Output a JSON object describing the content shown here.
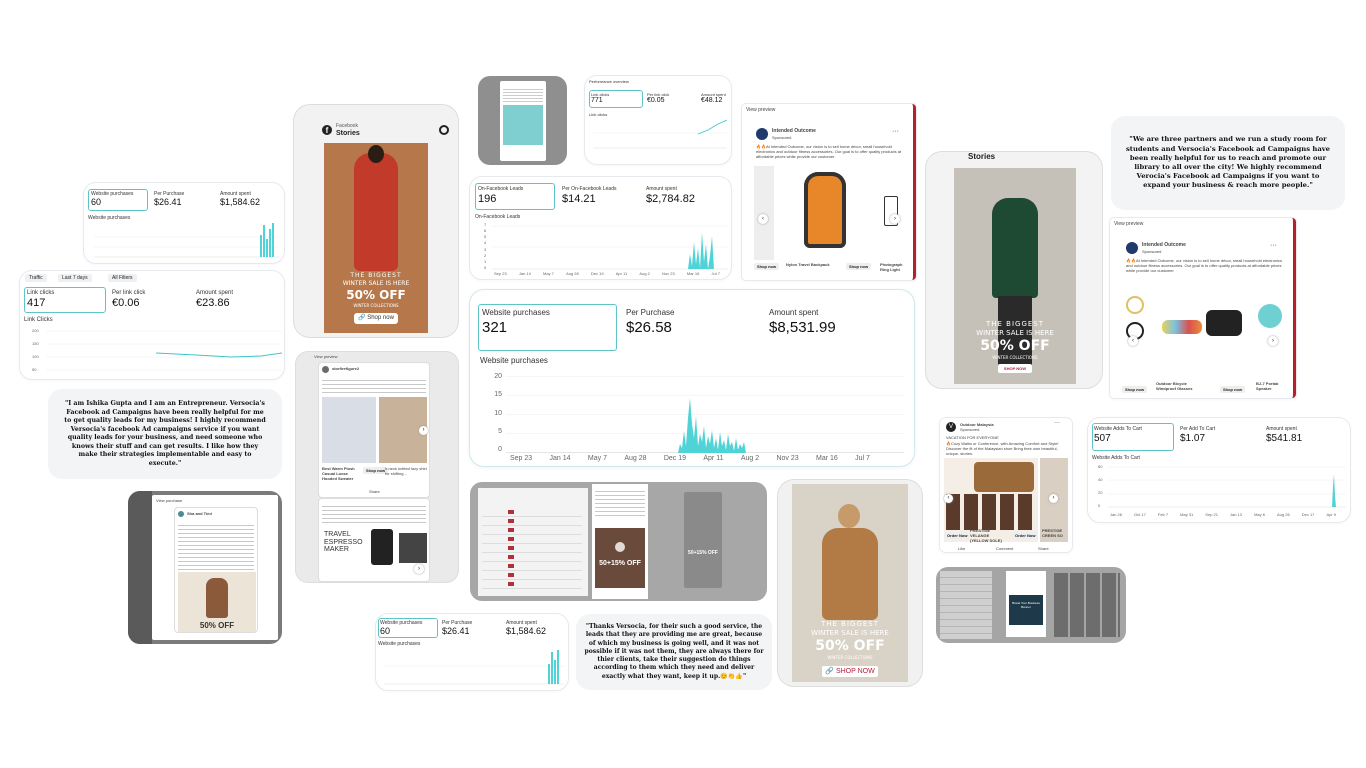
{
  "palette": {
    "teal": "#3ec6c9",
    "bar": "#4fd3d6",
    "card_border": "#5fc4c8",
    "dark_red": "#8a2020"
  },
  "card_a": {
    "m1_label": "Website purchases",
    "m1_value": "60",
    "m2_label": "Per Purchase",
    "m2_value": "$26.41",
    "m3_label": "Amount spent",
    "m3_value": "$1,584.62",
    "chart_label": "Website purchases"
  },
  "card_b": {
    "filter1": "Traffic",
    "filter2": "Last 7 days",
    "filter3": "All Filters",
    "m1_label": "Link clicks",
    "m1_value": "417",
    "m2_label": "Per link click",
    "m2_value": "€0.06",
    "m3_label": "Amount spent",
    "m3_value": "€23.86",
    "chart_label": "Link Clicks",
    "y_ticks": [
      "200",
      "150",
      "100",
      "50"
    ]
  },
  "quote1": "\"I am Ishika Gupta and I am an Entrepreneur. Versocia's Facebook ad Campaigns have been really helpful for me to get quality leads for my business! I highly recommend Versocia's facebook Ad campaigns service if you want quality leads for your business, and need someone who knows their stuff and can get results. I like how they make their strategies implementable and easy to execute.\"",
  "quote2": "\"We are three partners and we run a study room for students and Versocia's Facebook ad Campaigns have been really helpful for us to reach and promote our library to all over the city! We highly recommend Verocia's Facebook ad Campaigns if you want to expand your business & reach more people.\"",
  "quote3": "\"Thanks Versocia, for their such a good service, the leads that they are providing me are great, because of which my business is going well, and it was not possible if it was not them, they are always there for thier clients, take their suggestion do things according to them which they need and deliver exactly what they want, keep it up.😊👏👍\"",
  "story1": {
    "platform": "Facebook",
    "sub": "Stories",
    "line1": "THE BIGGEST",
    "line2": "WINTER SALE IS HERE",
    "big": "50% OFF",
    "line3": "WINTER COLLECTIONS",
    "cta": "Shop now"
  },
  "story2": {
    "header": "Stories",
    "line1": "THE BIGGEST",
    "line2": "WINTER SALE IS HERE",
    "big": "50% OFF",
    "line3": "WINTER COLLECTIONS",
    "cta": "SHOP NOW"
  },
  "story3": {
    "line1": "THE BIGGEST",
    "line2": "WINTER SALE IS HERE",
    "big": "50% OFF",
    "line3": "WINTER COLLECTIONS",
    "cta": "SHOP NOW"
  },
  "perf_small": {
    "title": "Performance overview",
    "m1_label": "Link clicks",
    "m1_value": "771",
    "m2_label": "Per link click",
    "m2_value": "€0.05",
    "m3_label": "Amount spent",
    "m3_value": "€48.12",
    "chart_label": "Link clicks"
  },
  "leads": {
    "m1_label": "On-Facebook Leads",
    "m1_value": "196",
    "m2_label": "Per On-Facebook Leads",
    "m2_value": "$14.21",
    "m3_label": "Amount spent",
    "m3_value": "$2,784.82",
    "chart_label": "On-Facebook Leads",
    "y_ticks": [
      "7",
      "6",
      "5",
      "4",
      "3",
      "2",
      "1",
      "0"
    ],
    "x_ticks": [
      "Sep 23",
      "Jan 14",
      "May 7",
      "Aug 28",
      "Dec 19",
      "Apr 11",
      "Aug 2",
      "Nov 23",
      "Mar 16",
      "Jul 7"
    ]
  },
  "main": {
    "m1_label": "Website purchases",
    "m1_value": "321",
    "m2_label": "Per Purchase",
    "m2_value": "$26.58",
    "m3_label": "Amount spent",
    "m3_value": "$8,531.99",
    "chart_label": "Website purchases",
    "y_ticks": [
      "20",
      "15",
      "10",
      "5",
      "0"
    ],
    "x_ticks": [
      "Sep 23",
      "Jan 14",
      "May 7",
      "Aug 28",
      "Dec 19",
      "Apr 11",
      "Aug 2",
      "Nov 23",
      "Mar 16",
      "Jul 7"
    ]
  },
  "adds": {
    "m1_label": "Website Adds To Cart",
    "m1_value": "507",
    "m2_label": "Per Add To Cart",
    "m2_value": "$1.07",
    "m3_label": "Amount spent",
    "m3_value": "$541.81",
    "chart_label": "Website Adds To Cart",
    "y_ticks": [
      "60",
      "40",
      "20",
      "0"
    ],
    "x_ticks": [
      "Jan 26",
      "Oct 17",
      "Feb 7",
      "May 31",
      "Sep 21",
      "Jan 13",
      "May 6",
      "Aug 26",
      "Dec 17",
      "Apr 9"
    ]
  },
  "view1": {
    "title": "View preview",
    "page": "Intended Outcome",
    "sponsored": "Sponsored",
    "body": "🔥🔥At Intended Outcome, our vision is to sell home décor, small household electronics and outdoor fitness accessories. Our goal is to offer quality products at affordable prices while provide our customer",
    "item1": "Shop now",
    "item2": "Nylon Travel Backpack",
    "item2_btn": "Shop now",
    "item3": "Photograph Ring Light"
  },
  "view2": {
    "title": "View preview",
    "page": "Intended Outcome",
    "sponsored": "Sponsored",
    "body": "🔥🔥At Intended Outcome, our vision is to sell home décor, small household electronics and outdoor fitness accessories. Our goal is to offer quality products at affordable prices while provide our customer",
    "item1": "Shop now",
    "item2": "Outdoor Bicycle Windproof Glasses",
    "item2_btn": "Shop now",
    "item3": "BJ-7 Portab Speaker"
  },
  "outdoor": {
    "page": "Outdoor Malaysia",
    "sponsored": "Sponsored",
    "headline": "VACATION FOR EVERYONE",
    "body": "🔥Cozy Walks or Conference, with Amazing Comfort and Style! Discover the fit of the Malaysian shoe Bring their own beautiful, unique, stories.",
    "c1": "Order Now",
    "c2": "PRESTIGE VELANGE (YELLOW SOLE)",
    "c3": "Order Now",
    "c4": "PRESTIGE CREEN SO",
    "like": "Like",
    "comment": "Comment",
    "share": "Share"
  },
  "vp_posts": {
    "title": "View preview",
    "page": "storfirefigure2",
    "item1": "Best Warm Plush Casual Loose Hooded Sweater",
    "item1_btn": "Shop now",
    "item2": "h-neck knitted lazy shirt for shifting...",
    "share": "Share",
    "travel1": "TRAVEL",
    "travel2": "ESPRESSO",
    "travel3": "MAKER"
  },
  "vp_kid": {
    "title": "View purchase",
    "page": "Sha and Tied",
    "big": "50% OFF"
  },
  "shot_purple": {
    "promo": "50+15% OFF",
    "promo2": "50+15% OFF"
  },
  "shot_small1": {
    "line": "Hot Sale"
  },
  "shot_small2": {
    "line": "Brand Your Business Banner"
  }
}
